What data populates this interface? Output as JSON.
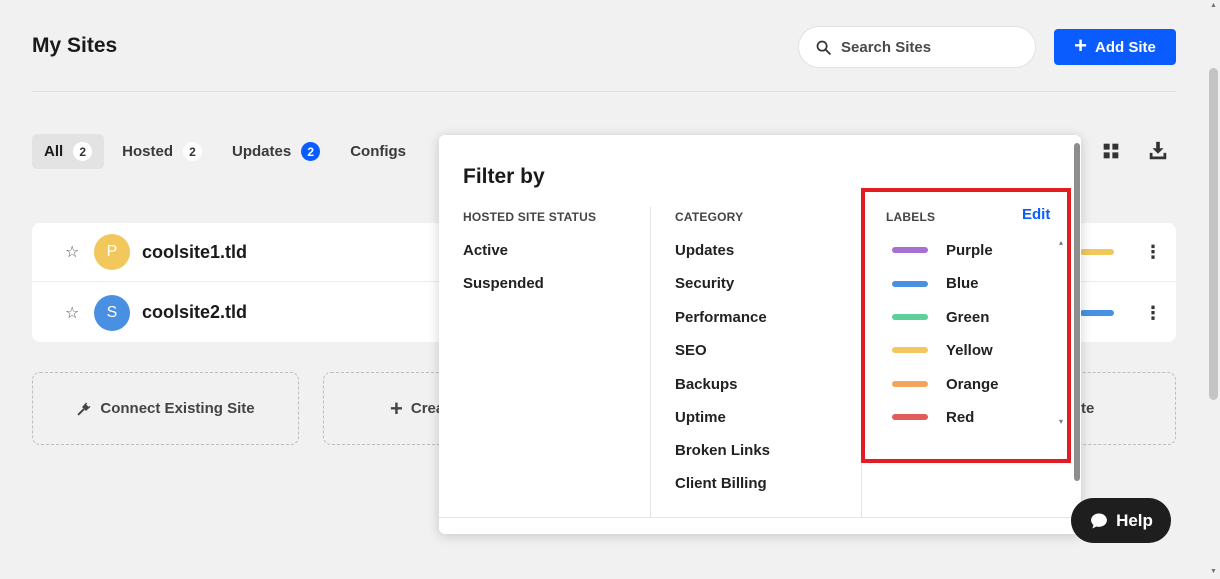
{
  "header": {
    "title": "My Sites",
    "search_placeholder": "Search Sites",
    "add_site_label": "Add Site"
  },
  "tabs": [
    {
      "label": "All",
      "count": "2"
    },
    {
      "label": "Hosted",
      "count": "2"
    },
    {
      "label": "Updates",
      "count": "2"
    },
    {
      "label": "Configs"
    }
  ],
  "sites": [
    {
      "name": "coolsite1.tld",
      "initial": "P",
      "avatar_color": "#f2c75c",
      "label_color": "#f2c75c"
    },
    {
      "name": "coolsite2.tld",
      "initial": "S",
      "avatar_color": "#4a90e2",
      "label_color": "#4a90e2"
    }
  ],
  "cards": {
    "connect_label": "Connect Existing Site",
    "create_label": "Crea",
    "third_label": "te"
  },
  "filter": {
    "title": "Filter by",
    "hosted_status": {
      "heading": "HOSTED SITE STATUS",
      "options": [
        "Active",
        "Suspended"
      ]
    },
    "category": {
      "heading": "CATEGORY",
      "options": [
        "Updates",
        "Security",
        "Performance",
        "SEO",
        "Backups",
        "Uptime",
        "Broken Links",
        "Client Billing"
      ]
    },
    "labels": {
      "heading": "LABELS",
      "edit_label": "Edit",
      "options": [
        {
          "name": "Purple",
          "color": "#a66fd4"
        },
        {
          "name": "Blue",
          "color": "#4a90e2"
        },
        {
          "name": "Green",
          "color": "#5ccf9a"
        },
        {
          "name": "Yellow",
          "color": "#f2c75c"
        },
        {
          "name": "Orange",
          "color": "#f2a35c"
        },
        {
          "name": "Red",
          "color": "#e25c5c"
        }
      ]
    }
  },
  "help_label": "Help",
  "colors": {
    "accent": "#0b5cff",
    "highlight": "#e31c24"
  }
}
